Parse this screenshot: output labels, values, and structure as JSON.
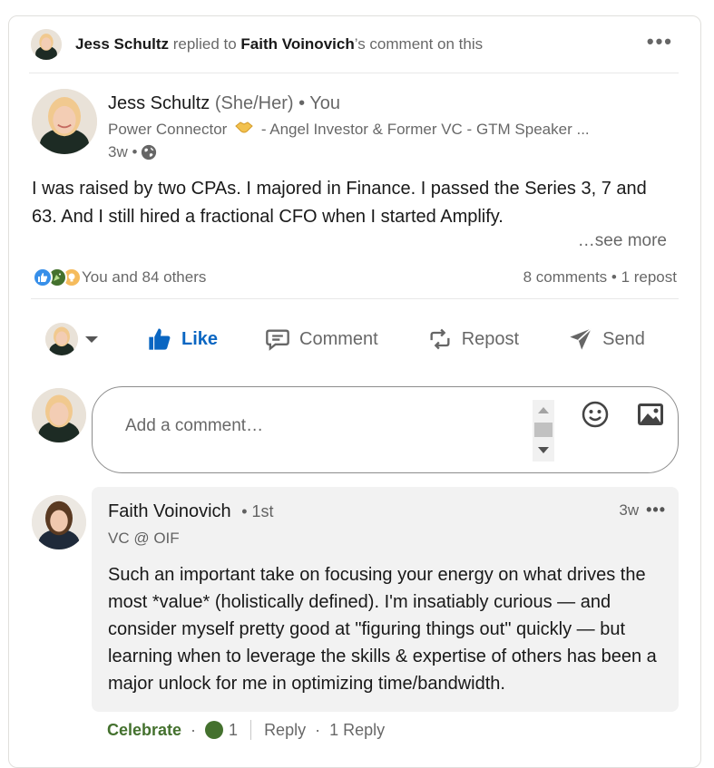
{
  "header": {
    "actor": "Jess Schultz",
    "replied_to_text": "replied to",
    "target": "Faith Voinovich",
    "suffix": "’s comment on this",
    "more_label": "•••"
  },
  "post": {
    "author_name": "Jess Schultz",
    "pronouns": "(She/Her)",
    "relation": "• You",
    "headline_prefix": "Power Connector",
    "headline_rest": "- Angel Investor & Former VC - GTM Speaker ...",
    "time": "3w •",
    "text": "I was raised by two CPAs. I majored in Finance. I passed the Series 3, 7 and 63. And I still hired a fractional CFO when I started Amplify.",
    "see_more": "…see more"
  },
  "social": {
    "reactions_text": "You and 84 others",
    "comments_text": "8 comments • 1 repost"
  },
  "actions": {
    "like": "Like",
    "comment": "Comment",
    "repost": "Repost",
    "send": "Send"
  },
  "comment_box": {
    "placeholder": "Add a comment…"
  },
  "reply": {
    "name": "Faith Voinovich",
    "degree": "• 1st",
    "headline": "VC @ OIF",
    "time": "3w",
    "text": "Such an important take on focusing your energy on what drives the most *value* (holistically defined). I'm insatiably curious — and consider myself pretty good at \"figuring things out\" quickly — but learning when to leverage the skills & expertise of others has been a major unlock for me in optimizing time/bandwidth.",
    "celebrate_label": "Celebrate",
    "reaction_count": "1",
    "reply_label": "Reply",
    "replies_count": "1 Reply"
  },
  "colors": {
    "like_blue": "#0a66c2",
    "celebrate_green": "#44712e",
    "reply_bg": "#f2f2f2"
  }
}
